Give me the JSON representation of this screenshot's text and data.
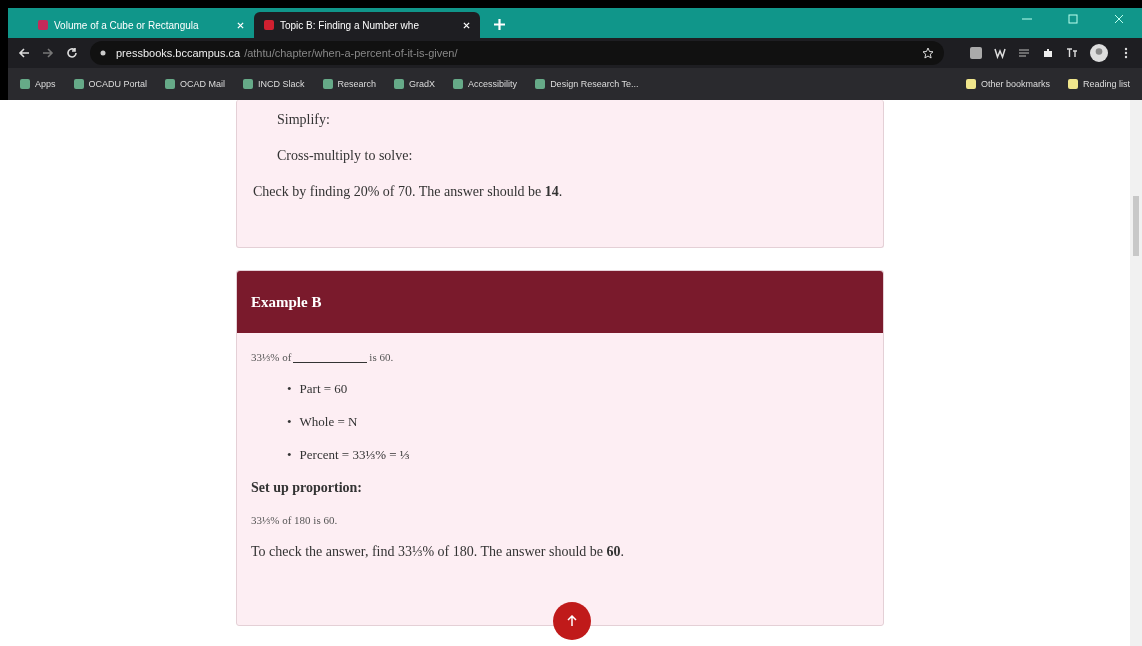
{
  "tabs": [
    {
      "title": "Volume of a Cube or Rectangula",
      "selected": false
    },
    {
      "title": "Topic B: Finding a Number whe",
      "selected": true
    }
  ],
  "address": {
    "host": "pressbooks.bccampus.ca",
    "path": "/athtu/chapter/when-a-percent-of-it-is-given/"
  },
  "bookmarks": [
    "Apps",
    "OCADU Portal",
    "OCAD Mail",
    "INCD Slack",
    "Research",
    "GradX",
    "Accessibility",
    "Design Research Te..."
  ],
  "bookmarks_right": [
    "Other bookmarks",
    "Reading list"
  ],
  "top_card": {
    "steps": [
      "Simplify:",
      "Cross-multiply to solve:"
    ],
    "check": "Check by finding 20% of 70. The answer should be **14**."
  },
  "example": {
    "title": "Example B",
    "problem_before": "33⅓% of",
    "problem_after": "is 60.",
    "bullets": [
      {
        "marker": "•",
        "text": "Part = 60"
      },
      {
        "marker": "•",
        "text": "Whole = N"
      },
      {
        "marker": "•",
        "text": "Percent = 33⅓% = ⅓"
      }
    ],
    "heading": "Set up proportion:",
    "statement": "33⅓% of 180 is 60.",
    "check": "To check the answer, find 33⅓% of 180. The answer should be **60**."
  }
}
